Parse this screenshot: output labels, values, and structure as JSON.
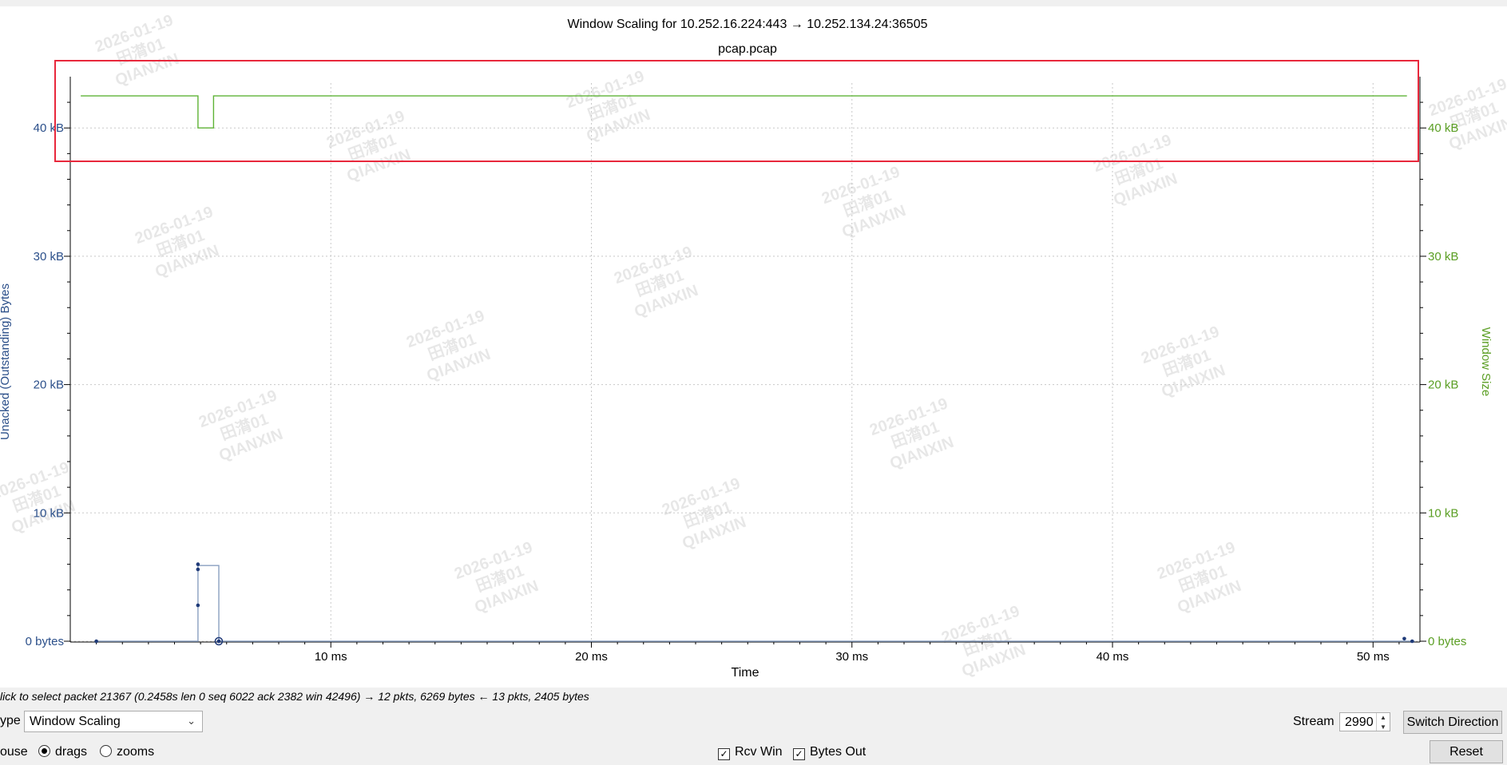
{
  "graph": {
    "title": "Window Scaling for 10.252.16.224:443 → 10.252.134.24:36505",
    "subtitle": "pcap.pcap",
    "xlabel": "Time",
    "ylabel_left": "Unacked (Outstanding) Bytes",
    "ylabel_right": "Window Size",
    "watermark_lines": [
      "2026-01-19",
      "田潸01",
      "QIANXIN"
    ]
  },
  "chart_data": {
    "type": "line",
    "x_unit": "ms",
    "xlim": [
      0,
      51.8
    ],
    "ylim": [
      0,
      43.5
    ],
    "y_unit": "kB",
    "x_ticks": [
      10,
      20,
      30,
      40,
      50
    ],
    "x_tick_labels": [
      "10 ms",
      "20 ms",
      "30 ms",
      "40 ms",
      "50 ms"
    ],
    "y_ticks": [
      0,
      10,
      20,
      30,
      40
    ],
    "y_tick_labels_left": [
      "0 bytes",
      "10 kB",
      "20 kB",
      "30 kB",
      "40 kB"
    ],
    "y_tick_labels_right": [
      "0 bytes",
      "10 kB",
      "20 kB",
      "30 kB",
      "40 kB"
    ],
    "grid": true,
    "series": [
      {
        "name": "Rcv Win",
        "axis": "right",
        "color": "#5fb336",
        "step": true,
        "points": [
          [
            0.4,
            42.5
          ],
          [
            4.9,
            42.5
          ],
          [
            4.9,
            40.0
          ],
          [
            5.5,
            40.0
          ],
          [
            5.5,
            42.5
          ],
          [
            51.3,
            42.5
          ]
        ]
      },
      {
        "name": "Bytes Out",
        "axis": "left",
        "color": "#8a9fc0",
        "marker_color": "#1f3a78",
        "step": true,
        "points": [
          [
            1.0,
            0.0
          ],
          [
            4.9,
            0.0
          ],
          [
            4.9,
            5.9
          ],
          [
            5.7,
            5.9
          ],
          [
            5.7,
            0.0
          ],
          [
            51.6,
            0.0
          ]
        ],
        "markers": [
          [
            1.0,
            0.0
          ],
          [
            4.9,
            2.8
          ],
          [
            4.9,
            5.6
          ],
          [
            4.9,
            6.0
          ],
          [
            5.7,
            0.0
          ],
          [
            51.2,
            0.2
          ],
          [
            51.5,
            0.0
          ]
        ],
        "highlighted_point": [
          5.7,
          0.0
        ]
      }
    ]
  },
  "annotation": {
    "color": "#e8283c"
  },
  "status": {
    "hint": "lick to select packet 21367 (0.2458s len 0 seq 6022 ack 2382 win 42496) → 12 pkts, 6269 bytes ← 13 pkts, 2405 bytes"
  },
  "controls": {
    "type_label": "ype",
    "type_value": "Window Scaling",
    "stream_label": "Stream",
    "stream_value": "2990",
    "switch_direction": "Switch Direction",
    "mouse_label": "ouse",
    "drags_label": "drags",
    "zooms_label": "zooms",
    "rcv_win_label": "Rcv Win",
    "bytes_out_label": "Bytes Out",
    "reset_label": "Reset"
  }
}
